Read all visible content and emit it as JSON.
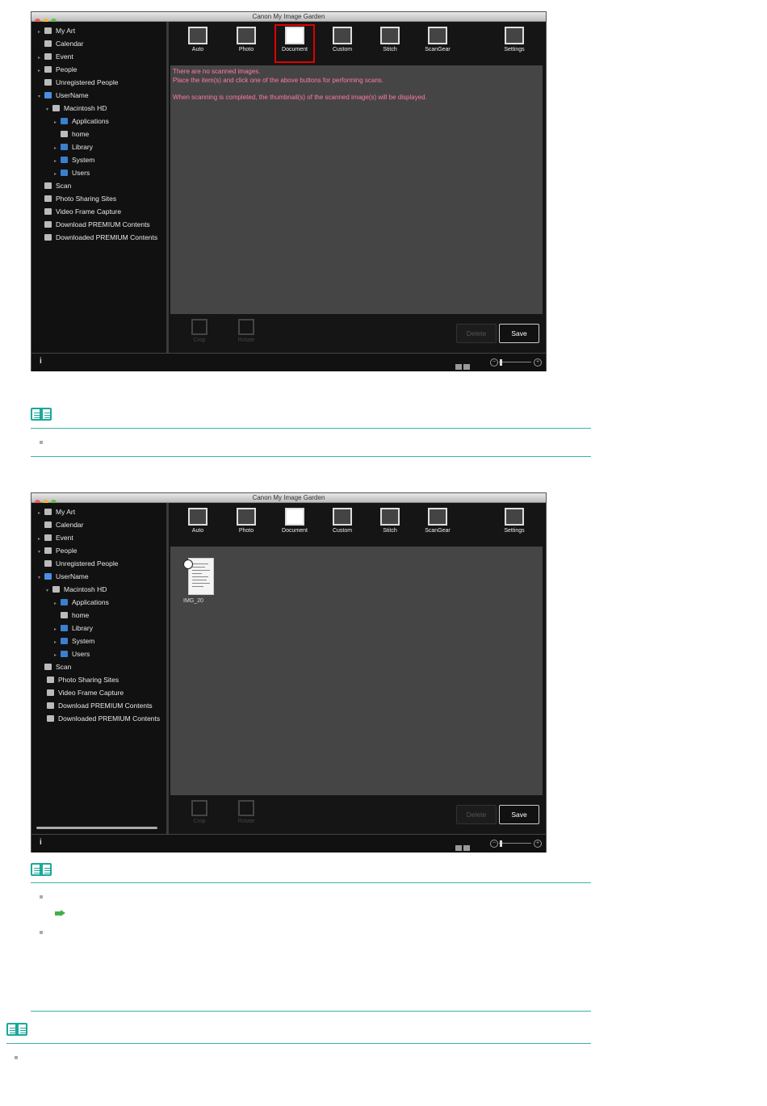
{
  "app": {
    "window_title": "Canon My Image Garden"
  },
  "sidebar": {
    "items": [
      {
        "label": "My Art"
      },
      {
        "label": "Calendar"
      },
      {
        "label": "Event"
      },
      {
        "label": "People"
      },
      {
        "label": "Unregistered People"
      },
      {
        "label": "UserName"
      },
      {
        "label": "Macintosh HD"
      },
      {
        "label": "Applications"
      },
      {
        "label": "home"
      },
      {
        "label": "Library"
      },
      {
        "label": "System"
      },
      {
        "label": "Users"
      },
      {
        "label": "Scan"
      },
      {
        "label": "Photo Sharing Sites"
      },
      {
        "label": "Video Frame Capture"
      },
      {
        "label": "Download PREMIUM Contents"
      },
      {
        "label": "Downloaded PREMIUM Contents"
      }
    ]
  },
  "toolbar": {
    "auto": "Auto",
    "photo": "Photo",
    "document": "Document",
    "custom": "Custom",
    "stitch": "Stitch",
    "scangear": "ScanGear",
    "settings": "Settings"
  },
  "messages": {
    "line1": "There are no scanned images.",
    "line2": "Place the item(s) and click one of the above buttons for performing scans.",
    "line3": "When scanning is completed, the thumbnail(s) of the scanned image(s) will be displayed."
  },
  "bottom": {
    "crop": "Crop",
    "rotate": "Rotate",
    "delete": "Delete",
    "save": "Save"
  },
  "status": {
    "info": "i"
  },
  "thumbnail": {
    "name": "IMG_20"
  },
  "colors": {
    "selection_highlight": "#e00000",
    "message_text": "#ff7aa8",
    "note_teal": "#1aa89b"
  }
}
